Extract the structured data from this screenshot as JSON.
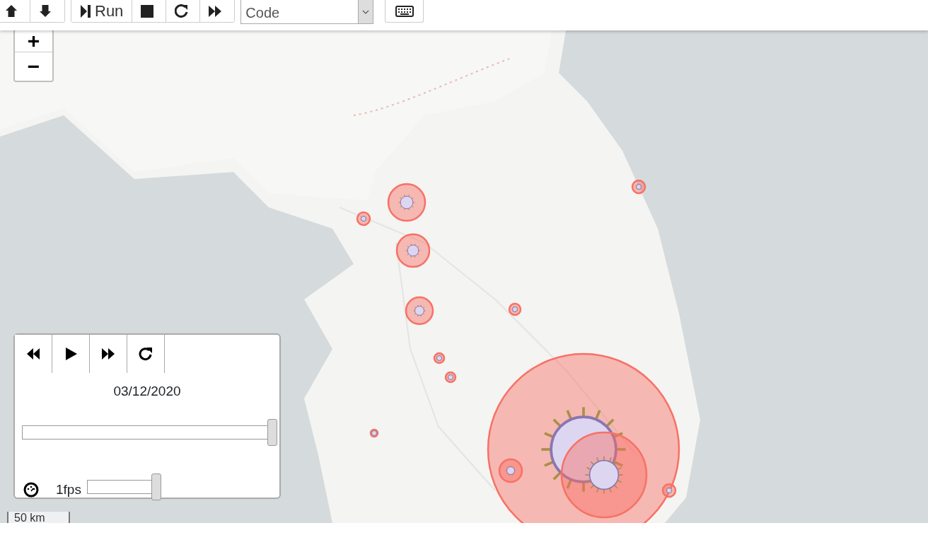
{
  "toolbar": {
    "groups": [
      [
        {
          "kind": "up"
        },
        {
          "kind": "down"
        }
      ],
      [
        {
          "kind": "step",
          "label": "Run"
        },
        {
          "kind": "stop"
        },
        {
          "kind": "restart"
        },
        {
          "kind": "fast-forward"
        }
      ]
    ],
    "cell_type": {
      "value": "Code"
    },
    "keyboard_button": {
      "kind": "keyboard"
    }
  },
  "map": {
    "kind": "picture",
    "zoom_buttons": [
      "+",
      "−"
    ],
    "scale": "50 km"
  },
  "player": {
    "buttons": [
      {
        "kind": "back"
      },
      {
        "kind": "play"
      },
      {
        "kind": "forward"
      },
      {
        "kind": "loop"
      }
    ],
    "date": "03/12/2020",
    "time_slider": {
      "level": 1
    },
    "speed": {
      "label": "1fps",
      "level": 1
    }
  }
}
